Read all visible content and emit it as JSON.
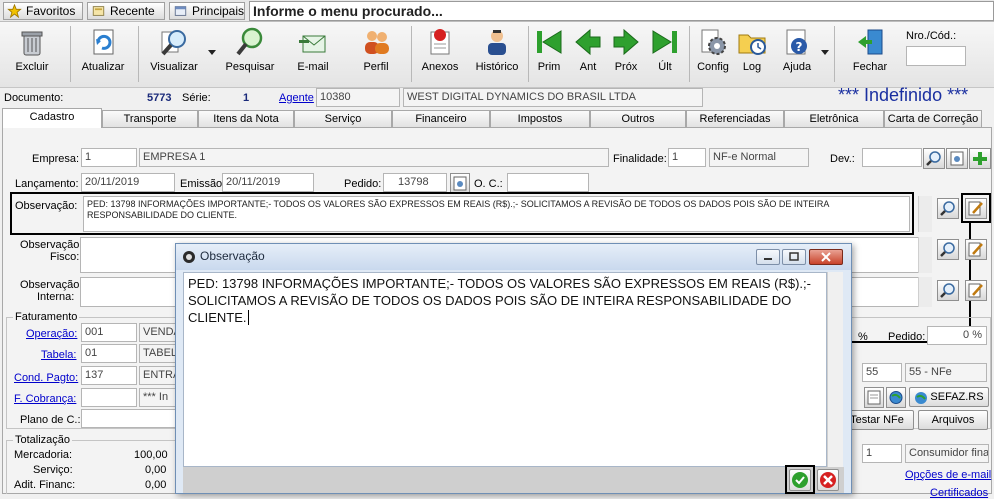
{
  "topbar": {
    "favoritos": "Favoritos",
    "recente": "Recente",
    "principais": "Principais",
    "menu_search": "Informe o menu procurado..."
  },
  "toolbar": {
    "excluir": "Excluir",
    "atualizar": "Atualizar",
    "visualizar": "Visualizar",
    "pesquisar": "Pesquisar",
    "email": "E-mail",
    "perfil": "Perfil",
    "anexos": "Anexos",
    "historico": "Histórico",
    "prim": "Prim",
    "ant": "Ant",
    "prox": "Próx",
    "ult": "Últ",
    "config": "Config",
    "log": "Log",
    "ajuda": "Ajuda",
    "fechar": "Fechar",
    "nro_cod_label": "Nro./Cód.:"
  },
  "document": {
    "label": "Documento:",
    "number": "5773",
    "serie_label": "Série:",
    "serie": "1",
    "agente_label": "Agente",
    "agente_code": "10380",
    "agente_name": "WEST DIGITAL DYNAMICS DO BRASIL LTDA",
    "status": "*** Indefinido ***"
  },
  "tabs": [
    "Cadastro",
    "Transporte",
    "Itens da Nota",
    "Serviço",
    "Financeiro",
    "Impostos",
    "Outros",
    "Referenciadas",
    "Eletrônica",
    "Carta de Correção"
  ],
  "form": {
    "empresa_label": "Empresa:",
    "empresa_code": "1",
    "empresa_name": "EMPRESA 1",
    "finalidade_label": "Finalidade:",
    "finalidade_code": "1",
    "finalidade_name": "NF-e Normal",
    "dev_label": "Dev.:",
    "lancamento_label": "Lançamento:",
    "lancamento": "20/11/2019",
    "emissao_label": "Emissão",
    "emissao": "20/11/2019",
    "pedido_label": "Pedido:",
    "pedido": "13798",
    "oc_label": "O. C.:",
    "observacao_label": "Observação:",
    "observacao": "PED: 13798 INFORMAÇÕES IMPORTANTE;- TODOS OS VALORES SÃO EXPRESSOS EM REAIS (R$).;- SOLICITAMOS A REVISÃO DE TODOS OS DADOS POIS SÃO DE INTEIRA RESPONSABILIDADE DO CLIENTE.",
    "obs_fiscal_label_1": "Observação",
    "obs_fiscal_label_2": "Fisco:",
    "obs_interna_label_1": "Observação",
    "obs_interna_label_2": "Interna:"
  },
  "faturamento": {
    "title": "Faturamento",
    "operacao_label": "Operação:",
    "operacao_code": "001",
    "operacao_name": "VENDA",
    "tabela_label": "Tabela:",
    "tabela_code": "01",
    "tabela_name": "TABELA",
    "cond_label": "Cond. Pagto:",
    "cond_code": "137",
    "cond_name": "ENTRA",
    "cobranca_label": "F. Cobrança:",
    "cobranca_name": "*** In",
    "plano_label": "Plano de C.:",
    "pct": "%",
    "pedido_label": "Pedido:",
    "pedido_pct": "0 %",
    "modelo_code": "55",
    "modelo_name": "55 - NFe",
    "sefaz": "SEFAZ.RS",
    "testar": "Testar NFe",
    "arquivos": "Arquivos"
  },
  "totalizacao": {
    "title": "Totalização",
    "mercadoria_label": "Mercadoria:",
    "mercadoria": "100,00",
    "servico_label": "Serviço:",
    "servico": "0,00",
    "adit_label": "Adit. Financ:",
    "adit": "0,00",
    "consumidor_code": "1",
    "consumidor_name": "Consumidor final",
    "opcoes_email": "Opções de e-mail",
    "certificados": "Certificados"
  },
  "dialog": {
    "title": "Observação",
    "text": "PED: 13798 INFORMAÇÕES IMPORTANTE;- TODOS OS VALORES SÃO EXPRESSOS EM REAIS (R$).;- SOLICITAMOS A REVISÃO DE TODOS OS DADOS POIS SÃO DE INTEIRA RESPONSABILIDADE DO CLIENTE."
  }
}
